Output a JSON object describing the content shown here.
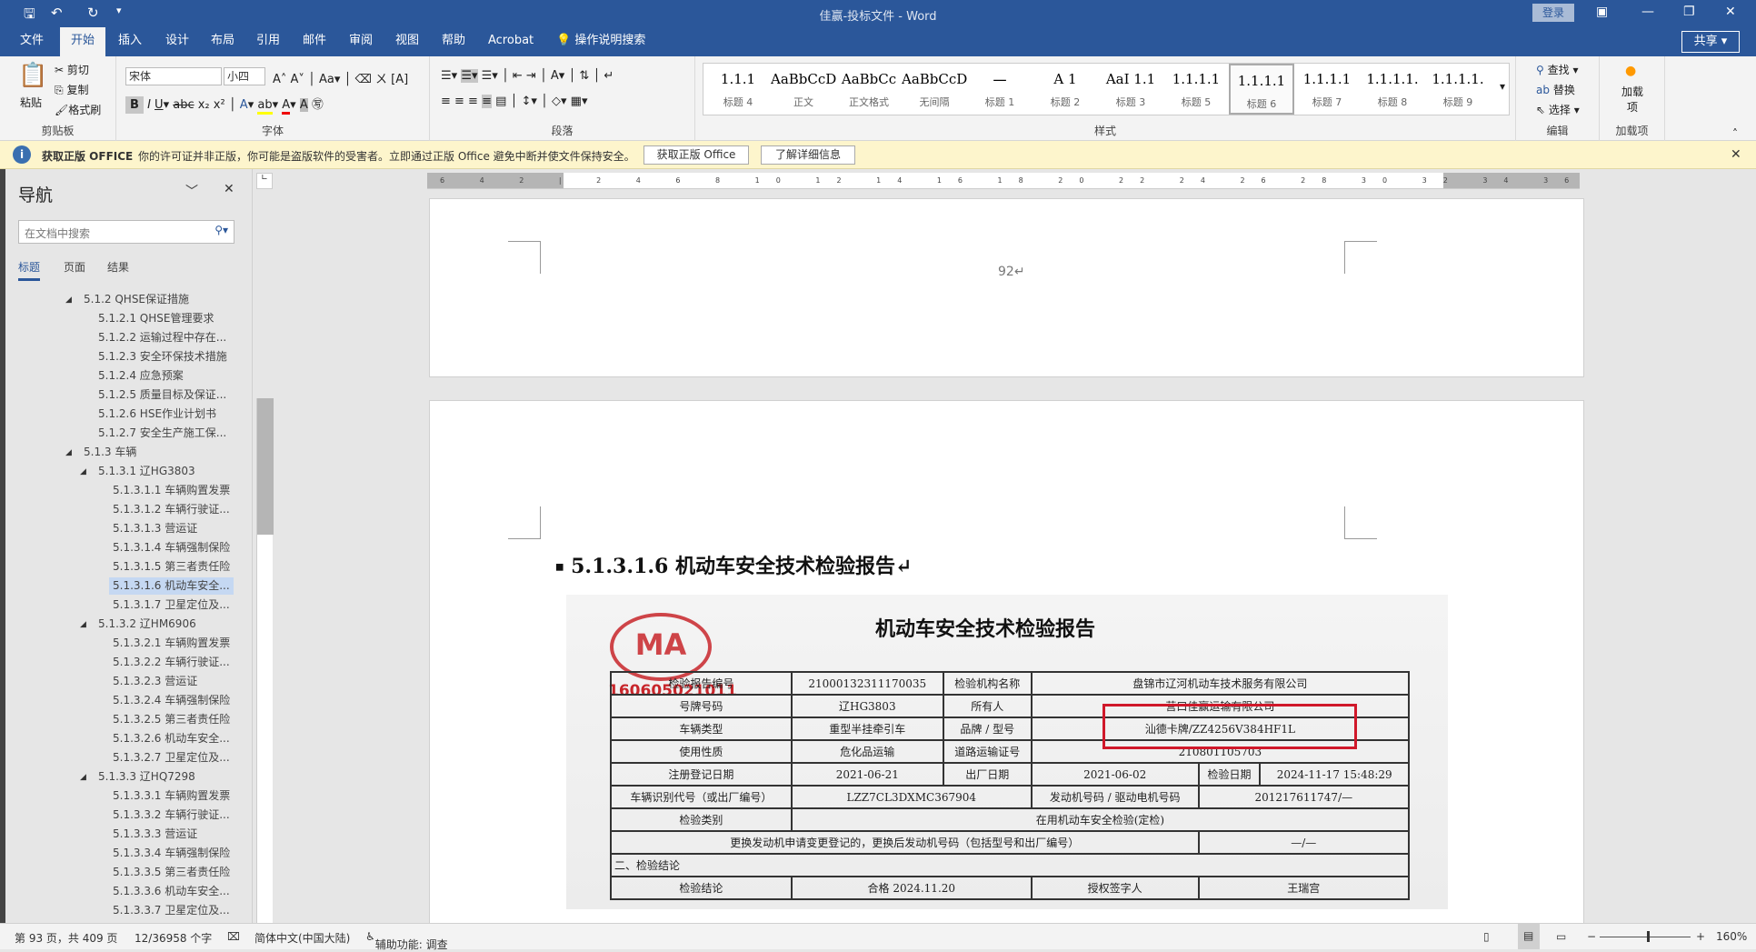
{
  "window": {
    "title": "佳赢-投标文件 - Word",
    "login": "登录",
    "share": "共享"
  },
  "tabs": [
    "文件",
    "开始",
    "插入",
    "设计",
    "布局",
    "引用",
    "邮件",
    "审阅",
    "视图",
    "帮助",
    "Acrobat",
    "操作说明搜索"
  ],
  "active_tab": "开始",
  "ribbon": {
    "clipboard": {
      "paste": "粘贴",
      "cut": "剪切",
      "copy": "复制",
      "format_painter": "格式刷",
      "label": "剪贴板"
    },
    "font": {
      "name": "宋体",
      "size": "小四",
      "label": "字体"
    },
    "paragraph": {
      "label": "段落"
    },
    "styles": {
      "label": "样式",
      "items": [
        {
          "preview": "1.1.1",
          "name": "标题 4"
        },
        {
          "preview": "AaBbCcDdI",
          "name": "正文"
        },
        {
          "preview": "AaBbCc",
          "name": "正文格式"
        },
        {
          "preview": "AaBbCcDdI",
          "name": "无间隔"
        },
        {
          "preview": "一",
          "name": "标题 1"
        },
        {
          "preview": "A 1",
          "name": "标题 2"
        },
        {
          "preview": "AaI 1.1",
          "name": "标题 3"
        },
        {
          "preview": "1.1.1.1",
          "name": "标题 5"
        },
        {
          "preview": "1.1.1.1",
          "name": "标题 6"
        },
        {
          "preview": "1.1.1.1",
          "name": "标题 7"
        },
        {
          "preview": "1.1.1.1.",
          "name": "标题 8"
        },
        {
          "preview": "1.1.1.1.",
          "name": "标题 9"
        }
      ],
      "selected": "标题 6"
    },
    "editing": {
      "find": "查找",
      "replace": "替换",
      "select": "选择",
      "label": "编辑"
    },
    "addins": {
      "button": "加载项",
      "label": "加载项"
    }
  },
  "infobar": {
    "title": "获取正版 OFFICE",
    "message": "你的许可证并非正版，你可能是盗版软件的受害者。立即通过正版 Office 避免中断并使文件保持安全。",
    "btn_get": "获取正版 Office",
    "btn_learn": "了解详细信息"
  },
  "nav": {
    "title": "导航",
    "search_placeholder": "在文档中搜索",
    "tabs": [
      "标题",
      "页面",
      "结果"
    ],
    "items": [
      {
        "text": "5.1.2 QHSE保证措施",
        "level": 0,
        "toggle": true
      },
      {
        "text": "5.1.2.1 QHSE管理要求",
        "level": 1
      },
      {
        "text": "5.1.2.2 运输过程中存在...",
        "level": 1
      },
      {
        "text": "5.1.2.3 安全环保技术措施",
        "level": 1
      },
      {
        "text": "5.1.2.4 应急预案",
        "level": 1
      },
      {
        "text": "5.1.2.5 质量目标及保证...",
        "level": 1
      },
      {
        "text": "5.1.2.6 HSE作业计划书",
        "level": 1
      },
      {
        "text": "5.1.2.7 安全生产施工保...",
        "level": 1
      },
      {
        "text": "5.1.3 车辆",
        "level": 0,
        "toggle": true
      },
      {
        "text": "5.1.3.1 辽HG3803",
        "level": 1,
        "toggle": true
      },
      {
        "text": "5.1.3.1.1 车辆购置发票",
        "level": 2
      },
      {
        "text": "5.1.3.1.2 车辆行驶证...",
        "level": 2
      },
      {
        "text": "5.1.3.1.3 营运证",
        "level": 2
      },
      {
        "text": "5.1.3.1.4 车辆强制保险",
        "level": 2
      },
      {
        "text": "5.1.3.1.5 第三者责任险",
        "level": 2
      },
      {
        "text": "5.1.3.1.6 机动车安全...",
        "level": 2,
        "selected": true
      },
      {
        "text": "5.1.3.1.7 卫星定位及...",
        "level": 2
      },
      {
        "text": "5.1.3.2 辽HM6906",
        "level": 1,
        "toggle": true
      },
      {
        "text": "5.1.3.2.1 车辆购置发票",
        "level": 2
      },
      {
        "text": "5.1.3.2.2 车辆行驶证...",
        "level": 2
      },
      {
        "text": "5.1.3.2.3 营运证",
        "level": 2
      },
      {
        "text": "5.1.3.2.4 车辆强制保险",
        "level": 2
      },
      {
        "text": "5.1.3.2.5 第三者责任险",
        "level": 2
      },
      {
        "text": "5.1.3.2.6 机动车安全...",
        "level": 2
      },
      {
        "text": "5.1.3.2.7 卫星定位及...",
        "level": 2
      },
      {
        "text": "5.1.3.3 辽HQ7298",
        "level": 1,
        "toggle": true
      },
      {
        "text": "5.1.3.3.1 车辆购置发票",
        "level": 2
      },
      {
        "text": "5.1.3.3.2 车辆行驶证...",
        "level": 2
      },
      {
        "text": "5.1.3.3.3 营运证",
        "level": 2
      },
      {
        "text": "5.1.3.3.4 车辆强制保险",
        "level": 2
      },
      {
        "text": "5.1.3.3.5 第三者责任险",
        "level": 2
      },
      {
        "text": "5.1.3.3.6 机动车安全...",
        "level": 2
      },
      {
        "text": "5.1.3.3.7 卫星定位及...",
        "level": 2
      }
    ]
  },
  "ruler": "6 4 2 | 2 4 6 8 10 12 14 16 18 20 22 24 26 28 30 32 34 36 38 40 42 | 44 46 48",
  "document": {
    "page_number": "92↵",
    "heading": "5.1.3.1.6  机动车安全技术检验报告↵",
    "scan": {
      "title": "机动车安全技术检验报告",
      "stamp": "MA",
      "stamp_no": "160605021011",
      "rows": [
        [
          "检验报告编号",
          "21000132311170035",
          "检验机构名称",
          "盘锦市辽河机动车技术服务有限公司"
        ],
        [
          "号牌号码",
          "辽HG3803",
          "所有人",
          "营口佳赢运输有限公司"
        ],
        [
          "车辆类型",
          "重型半挂牵引车",
          "品牌 / 型号",
          "汕德卡牌/ZZ4256V384HF1L"
        ],
        [
          "使用性质",
          "危化品运输",
          "道路运输证号",
          "210801105703"
        ]
      ],
      "row_dates": [
        "注册登记日期",
        "2021-06-21",
        "出厂日期",
        "2021-06-02",
        "检验日期",
        "2024-11-17 15:48:29"
      ],
      "row_vin": [
        "车辆识别代号（或出厂编号）",
        "LZZ7CL3DXMC367904",
        "发动机号码 / 驱动电机号码",
        "201217611747/—"
      ],
      "row_type": [
        "检验类别",
        "在用机动车安全检验(定检)"
      ],
      "row_engine": [
        "更换发动机申请变更登记的，更换后发动机号码（包括型号和出厂编号）",
        "—/—"
      ],
      "section2": "二、检验结论",
      "row_result": [
        "检验结论",
        "合格 2024.11.20",
        "授权签字人",
        "王瑞宫"
      ]
    }
  },
  "status": {
    "page": "第 93 页，共 409 页",
    "words": "12/36958 个字",
    "language": "简体中文(中国大陆)",
    "accessibility": "辅助功能: 调查",
    "zoom": "160%"
  },
  "colors": {
    "accent": "#2b579a",
    "infobar": "#fdf5cc",
    "highlight_box": "#d0182a"
  }
}
